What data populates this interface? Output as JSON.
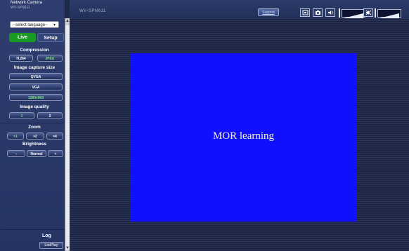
{
  "brand": {
    "vendor": "Network Camera",
    "model": "WV-SPN611"
  },
  "header": {
    "model_title": "WV-SPN611",
    "support_label": "Support"
  },
  "sidebar": {
    "language_select": "--select language--",
    "tabs": {
      "live": "Live",
      "setup": "Setup"
    },
    "compression": {
      "title": "Compression",
      "h264": "H.264",
      "jpeg": "JPEG"
    },
    "capture_size": {
      "title": "Image capture size",
      "qvga": "QVGA",
      "vga": "VGA",
      "hd": "1280x960"
    },
    "quality": {
      "title": "Image quality",
      "q1": "1",
      "q2": "2"
    },
    "zoom": {
      "title": "Zoom",
      "x1": "×1",
      "x2": "×2",
      "x4": "×4"
    },
    "brightness": {
      "title": "Brightness",
      "minus": "-",
      "normal": "Normal",
      "plus": "+"
    },
    "log": {
      "title": "Log",
      "listplay": "ListPlay"
    }
  },
  "video": {
    "caption": "MOR learning"
  },
  "colors": {
    "accent_green": "#179b22",
    "active_text": "#7ae07a",
    "video_bg": "#1010ff"
  },
  "icons": [
    "fullscreen-icon",
    "camera-snapshot-icon",
    "speaker-icon",
    "microphone-volume-icon",
    "mute-icon",
    "speaker-volume-icon"
  ]
}
